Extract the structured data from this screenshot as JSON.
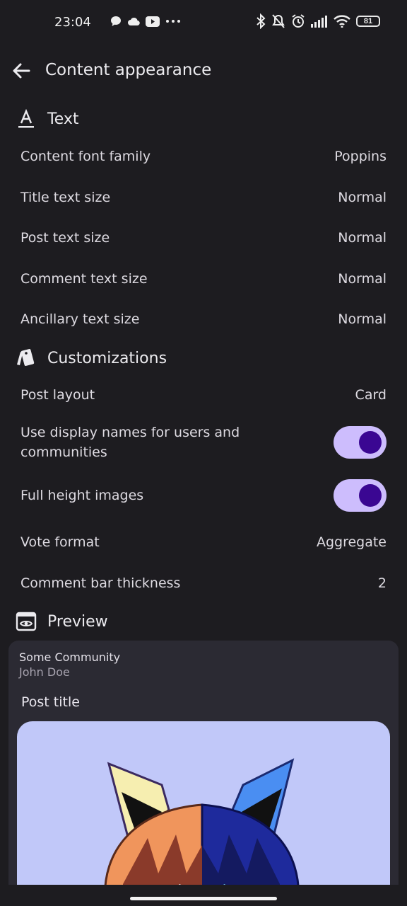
{
  "status": {
    "time": "23:04",
    "battery": "81"
  },
  "header": {
    "title": "Content appearance"
  },
  "sections": {
    "text": {
      "title": "Text",
      "rows": [
        {
          "label": "Content font family",
          "value": "Poppins"
        },
        {
          "label": "Title text size",
          "value": "Normal"
        },
        {
          "label": "Post text size",
          "value": "Normal"
        },
        {
          "label": "Comment text size",
          "value": "Normal"
        },
        {
          "label": "Ancillary text size",
          "value": "Normal"
        }
      ]
    },
    "customizations": {
      "title": "Customizations",
      "post_layout": {
        "label": "Post layout",
        "value": "Card"
      },
      "display_names": {
        "label": "Use display names for users and communities",
        "on": true
      },
      "full_height": {
        "label": "Full height images",
        "on": true
      },
      "vote_format": {
        "label": "Vote format",
        "value": "Aggregate"
      },
      "comment_bar": {
        "label": "Comment bar thickness",
        "value": "2"
      }
    },
    "preview": {
      "title": "Preview",
      "community": "Some Community",
      "author": "John Doe",
      "post_title": "Post title"
    }
  },
  "colors": {
    "background": "#1d1c20",
    "toggle_track": "#cdbdfd",
    "toggle_knob": "#3a0792",
    "card": "#2b2a33",
    "image_bg": "#c1c8f9"
  }
}
